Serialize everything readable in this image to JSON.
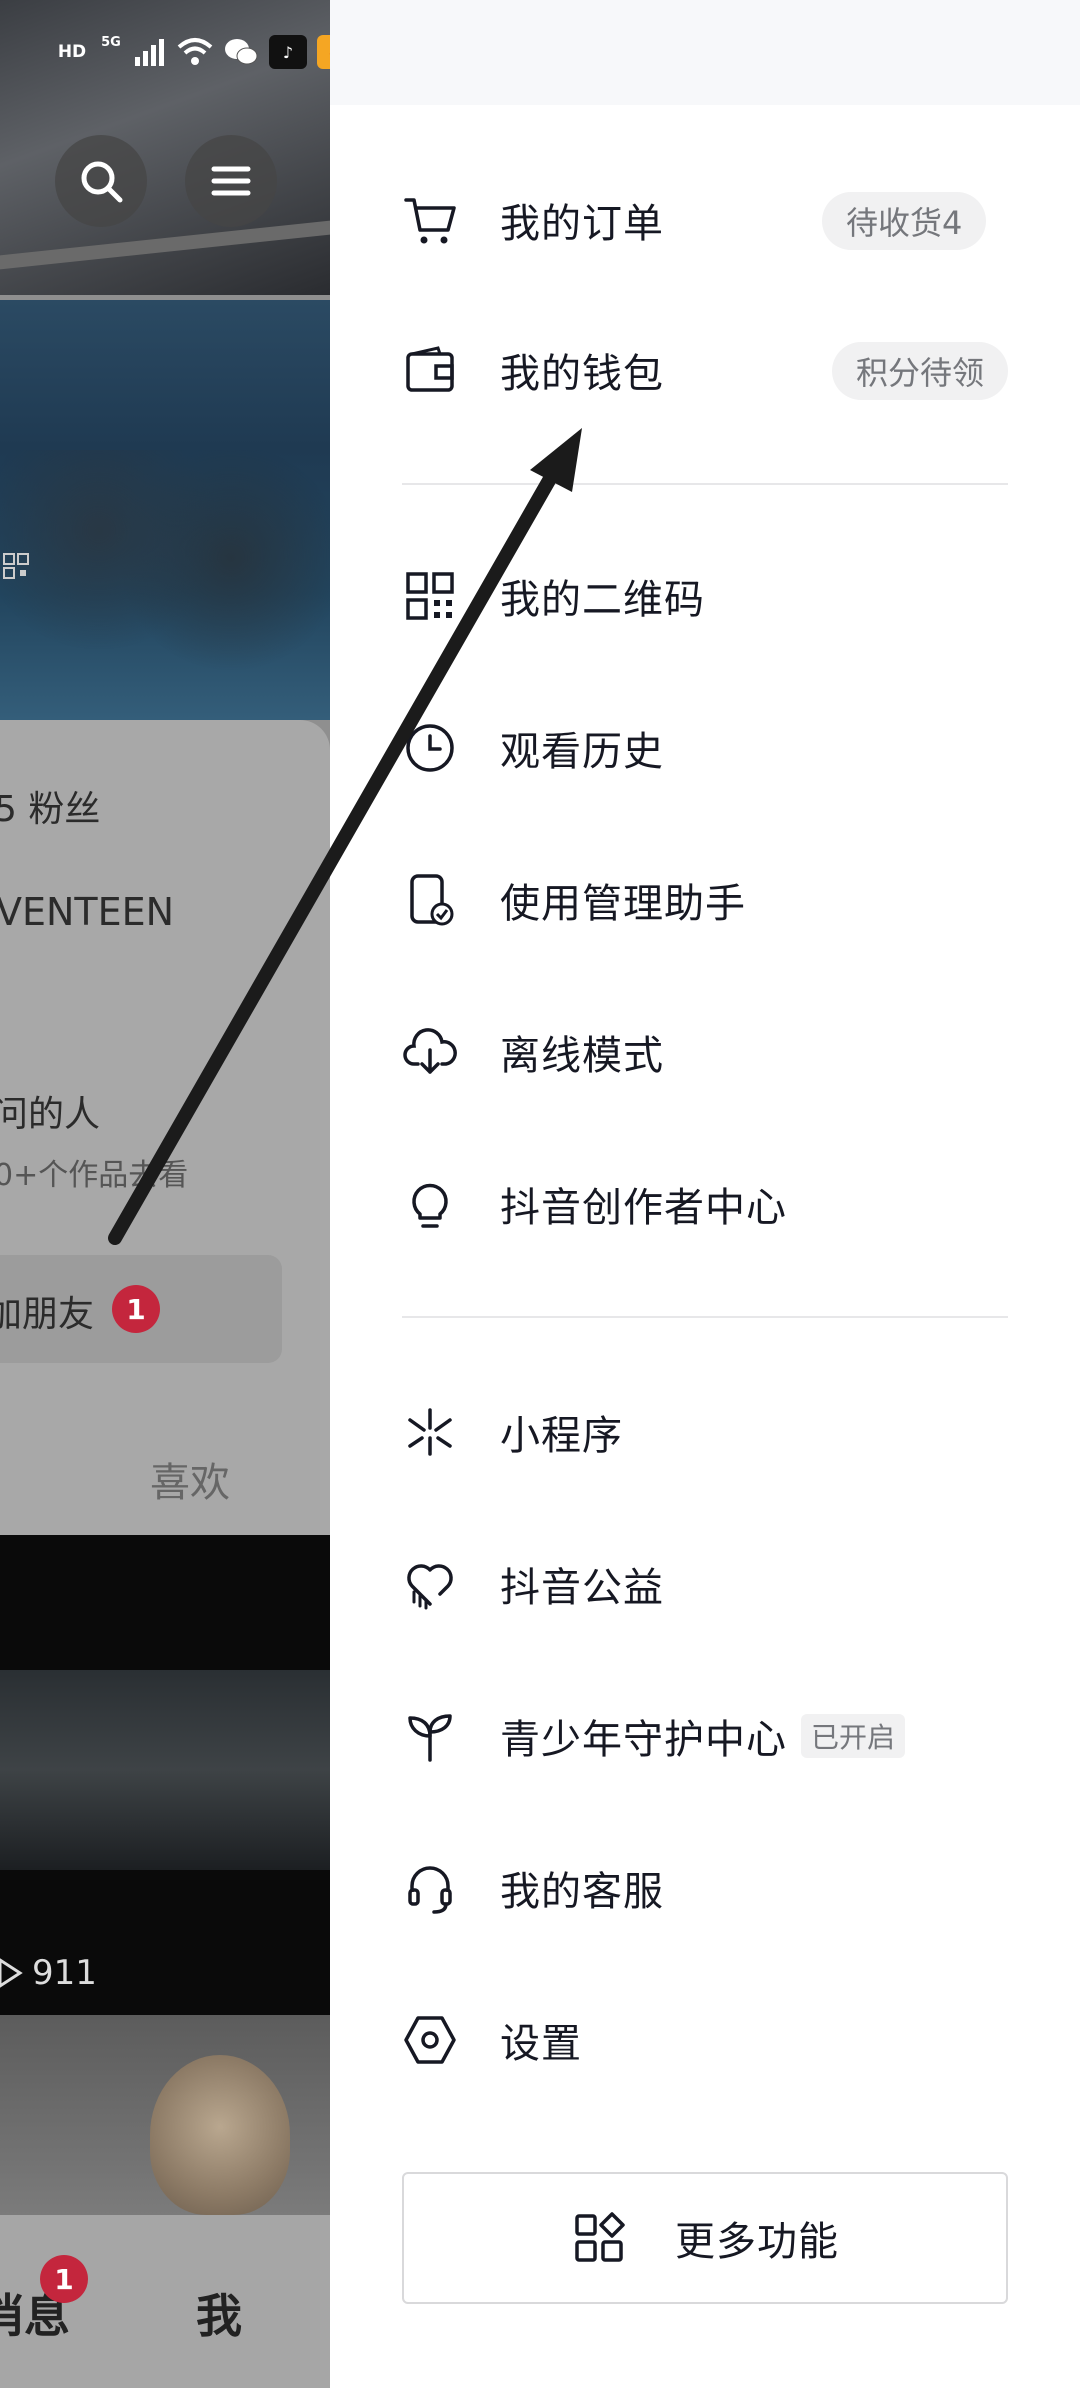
{
  "status_bar": {
    "hd": "HD",
    "net": "5G"
  },
  "profile_bg": {
    "fans_label": "5 粉丝",
    "name_fragment": "VENTEEN",
    "visitors_title": "问的人",
    "visitors_sub": "0+个作品去看",
    "friends_label": "加朋友",
    "friends_badge": "1",
    "likes_tab": "喜欢",
    "view_count": "911",
    "tab_messages": "消息",
    "tab_messages_badge": "1",
    "tab_me": "我"
  },
  "drawer": {
    "orders": {
      "label": "我的订单",
      "pill": "待收货4"
    },
    "wallet": {
      "label": "我的钱包",
      "pill": "积分待领"
    },
    "qrcode": {
      "label": "我的二维码"
    },
    "history": {
      "label": "观看历史"
    },
    "usage": {
      "label": "使用管理助手"
    },
    "offline": {
      "label": "离线模式"
    },
    "creator": {
      "label": "抖音创作者中心"
    },
    "mini_programs": {
      "label": "小程序"
    },
    "charity": {
      "label": "抖音公益"
    },
    "youth": {
      "label": "青少年守护中心",
      "tag": "已开启"
    },
    "service": {
      "label": "我的客服"
    },
    "settings": {
      "label": "设置"
    },
    "more": {
      "label": "更多功能"
    }
  },
  "colors": {
    "accent_badge": "#c4263d",
    "text": "#161823",
    "muted": "#75777c"
  }
}
